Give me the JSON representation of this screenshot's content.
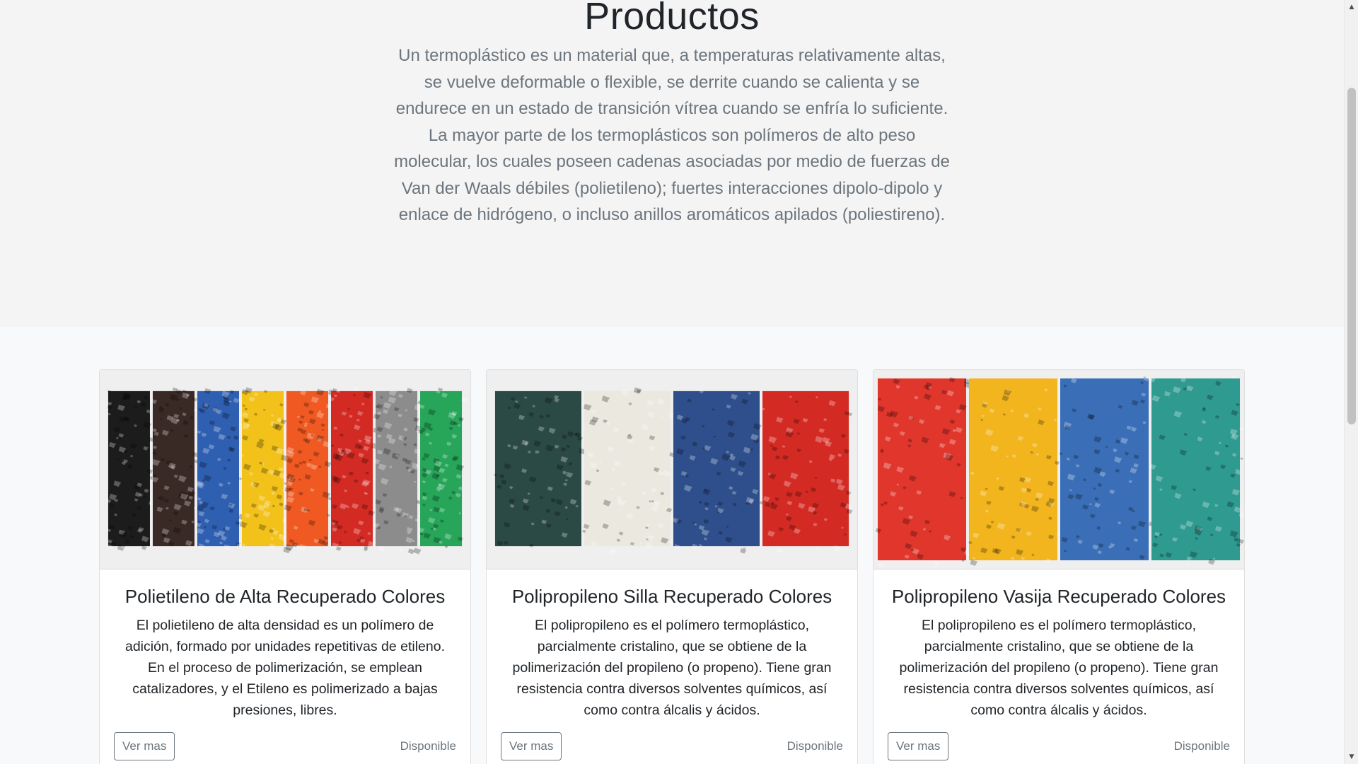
{
  "hero": {
    "title": "Productos",
    "description": "Un termoplástico es un material que, a temperaturas relativamente altas, se vuelve deformable o flexible, se derrite cuando se calienta y se endurece en un estado de transición vítrea cuando se enfría lo suficiente. La mayor parte de los termoplásticos son polímeros de alto peso molecular, los cuales poseen cadenas asociadas por medio de fuerzas de Van der Waals débiles (polietileno); fuertes interacciones dipolo-dipolo y enlace de hidrógeno, o incluso anillos aromáticos apilados (poliestireno)."
  },
  "products": [
    {
      "title": "Polietileno de Alta Recuperado Colores",
      "text": "El polietileno de alta densidad es un polímero de adición, formado por unidades repetitivas de etileno. En el proceso de polimerización, se emplean catalizadores, y el Etileno es polimerizado a bajas presiones, libres.",
      "button": "Ver mas",
      "status": "Disponible",
      "image_colors": [
        "#1c1c1c",
        "#3a2a26",
        "#2f5fb0",
        "#f2c21b",
        "#f05a22",
        "#d42a24",
        "#8c8c8c",
        "#27a65a"
      ]
    },
    {
      "title": "Polipropileno Silla Recuperado Colores",
      "text": "El polipropileno es el polímero termoplástico, parcialmente cristalino, que se obtiene de la polimerización del propileno (o propeno). Tiene gran resistencia contra diversos solventes químicos, así como contra álcalis y ácidos.",
      "button": "Ver mas",
      "status": "Disponible",
      "image_colors": [
        "#2b4a45",
        "#ebe8df",
        "#2f4f8c",
        "#d42a24"
      ]
    },
    {
      "title": "Polipropileno Vasija Recuperado Colores",
      "text": "El polipropileno es el polímero termoplástico, parcialmente cristalino, que se obtiene de la polimerización del propileno (o propeno). Tiene gran resistencia contra diversos solventes químicos, así como contra álcalis y ácidos.",
      "button": "Ver mas",
      "status": "Disponible",
      "image_colors": [
        "#e0362c",
        "#f2b51e",
        "#3a6fb8",
        "#2e9a90"
      ]
    }
  ],
  "scrollbar": {
    "up_icon": "triangle-up",
    "down_icon": "triangle-down"
  }
}
